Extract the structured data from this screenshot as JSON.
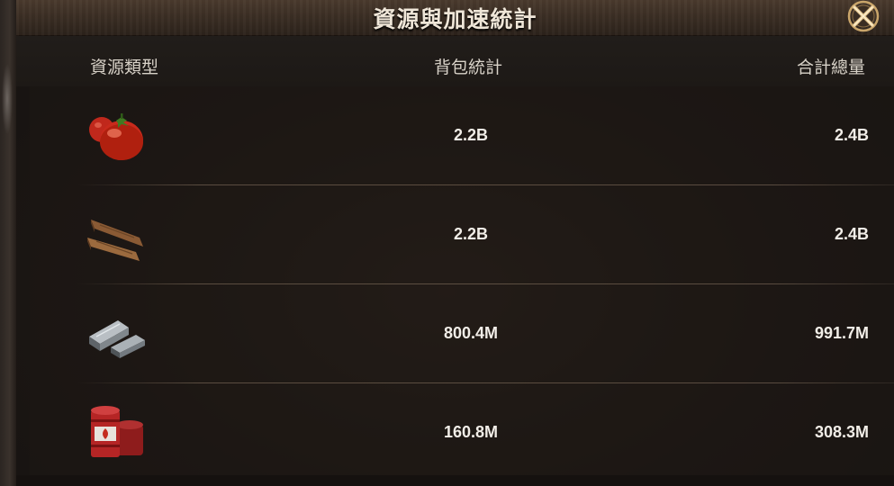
{
  "header": {
    "title": "資源與加速統計"
  },
  "columns": {
    "type": "資源類型",
    "bag": "背包統計",
    "total": "合計總量"
  },
  "rows": [
    {
      "icon": "tomato-icon",
      "bag": "2.2B",
      "total": "2.4B"
    },
    {
      "icon": "wood-planks-icon",
      "bag": "2.2B",
      "total": "2.4B"
    },
    {
      "icon": "steel-ingots-icon",
      "bag": "800.4M",
      "total": "991.7M"
    },
    {
      "icon": "oil-barrels-icon",
      "bag": "160.8M",
      "total": "308.3M"
    }
  ],
  "colors": {
    "text": "#f2eee8",
    "header_bg": "#3b2e24",
    "accent_gold": "#c9a56a"
  }
}
